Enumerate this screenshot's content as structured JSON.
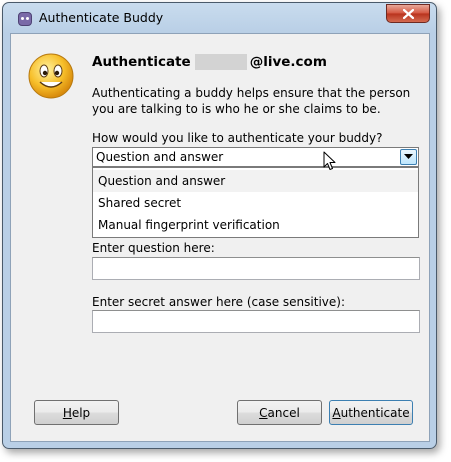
{
  "window": {
    "title": "Authenticate Buddy"
  },
  "header": {
    "prefix": "Authenticate",
    "account_suffix": "@live.com"
  },
  "description": "Authenticating a buddy helps ensure that the person you are talking to is who he or she claims to be.",
  "method": {
    "label": "How would you like to authenticate your buddy?",
    "selected": "Question and answer",
    "options": [
      "Question and answer",
      "Shared secret",
      "Manual fingerprint verification"
    ]
  },
  "question": {
    "label": "Enter question here:",
    "value": ""
  },
  "answer": {
    "label": "Enter secret answer here (case sensitive):",
    "value": ""
  },
  "buttons": {
    "help": {
      "mnemonic": "H",
      "rest": "elp"
    },
    "cancel": {
      "mnemonic": "C",
      "rest": "ancel"
    },
    "authenticate": {
      "mnemonic": "A",
      "rest": "uthenticate"
    }
  },
  "colors": {
    "accent": "#3c7fb1",
    "close": "#c8402a",
    "smiley": "#f5b21a"
  }
}
